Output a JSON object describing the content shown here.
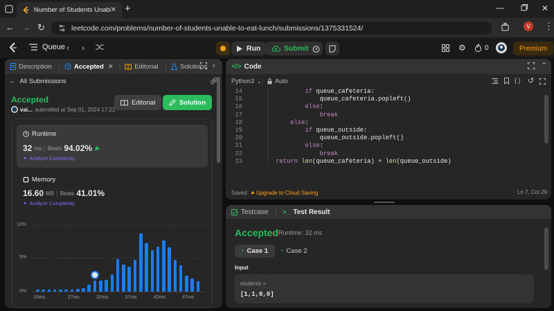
{
  "browser": {
    "tab_title": "Number of Students Unable to",
    "url": "leetcode.com/problems/number-of-students-unable-to-eat-lunch/submissions/1375331524/",
    "profile_initial": "V"
  },
  "header": {
    "list_label": "Queue",
    "run_label": "Run",
    "submit_label": "Submit",
    "fire_count": "0",
    "premium_label": "Premium"
  },
  "left": {
    "tabs": [
      "Description",
      "Accepted",
      "Editorial",
      "Solutions"
    ],
    "all_submissions": "All Submissions",
    "status": "Accepted",
    "user": "vai...",
    "submitted_at": "submitted at Sep 01, 2024 17:22",
    "editorial_button": "Editorial",
    "solution_button": "Solution",
    "runtime": {
      "label": "Runtime",
      "value": "32",
      "unit": "ms",
      "beats_label": "Beats",
      "beats": "94.02%",
      "analyze": "Analyze Complexity"
    },
    "memory": {
      "label": "Memory",
      "value": "16.60",
      "unit": "MB",
      "beats_label": "Beats",
      "beats": "41.01%",
      "analyze": "Analyze Complexity"
    }
  },
  "chart_data": {
    "type": "bar",
    "yticks": [
      "10%",
      "5%",
      "0%"
    ],
    "ylim": [
      0,
      10
    ],
    "xticks": [
      "10ms",
      "27ms",
      "32ms",
      "37ms",
      "42ms",
      "47ms"
    ],
    "values": [
      0.3,
      0.3,
      0.3,
      0.3,
      0.3,
      0.3,
      0.3,
      0.4,
      0.5,
      1.0,
      1.6,
      1.6,
      1.8,
      2.6,
      4.8,
      4.0,
      3.7,
      4.7,
      8.7,
      7.2,
      6.2,
      6.7,
      7.6,
      6.6,
      4.7,
      3.9,
      2.4,
      2.0,
      1.5
    ],
    "highlight_index": 10
  },
  "code": {
    "title": "Code",
    "language": "Python3",
    "mode": "Auto",
    "lines": [
      {
        "n": "14",
        "indent": 12,
        "parts": [
          {
            "t": "if",
            "c": "kw"
          },
          {
            "t": " queue_cafeteria:",
            "c": ""
          }
        ]
      },
      {
        "n": "15",
        "indent": 16,
        "parts": [
          {
            "t": "queue_cafeteria.popleft()",
            "c": ""
          }
        ]
      },
      {
        "n": "16",
        "indent": 12,
        "parts": [
          {
            "t": "else",
            "c": "kw"
          },
          {
            "t": ":",
            "c": ""
          }
        ]
      },
      {
        "n": "17",
        "indent": 16,
        "parts": [
          {
            "t": "break",
            "c": "kw"
          }
        ]
      },
      {
        "n": "18",
        "indent": 8,
        "parts": [
          {
            "t": "else",
            "c": "kw"
          },
          {
            "t": ":",
            "c": ""
          }
        ]
      },
      {
        "n": "19",
        "indent": 12,
        "parts": [
          {
            "t": "if",
            "c": "kw"
          },
          {
            "t": " queue_outside:",
            "c": ""
          }
        ]
      },
      {
        "n": "20",
        "indent": 16,
        "parts": [
          {
            "t": "queue_outside.popleft()",
            "c": ""
          }
        ]
      },
      {
        "n": "21",
        "indent": 12,
        "parts": [
          {
            "t": "else",
            "c": "kw"
          },
          {
            "t": ":",
            "c": ""
          }
        ]
      },
      {
        "n": "22",
        "indent": 16,
        "parts": [
          {
            "t": "break",
            "c": "kw"
          }
        ]
      },
      {
        "n": "23",
        "indent": 4,
        "parts": [
          {
            "t": "return",
            "c": "kw"
          },
          {
            "t": " ",
            "c": ""
          },
          {
            "t": "len",
            "c": "fn"
          },
          {
            "t": "(queue_cafeteria) + ",
            "c": ""
          },
          {
            "t": "len",
            "c": "fn"
          },
          {
            "t": "(queue_outside)",
            "c": ""
          }
        ]
      }
    ],
    "saved": "Saved",
    "upgrade": "Upgrade to Cloud Saving",
    "cursor": "Ln 7, Col 29"
  },
  "result": {
    "tab_testcase": "Testcase",
    "tab_result": "Test Result",
    "status": "Accepted",
    "runtime": "Runtime: 32 ms",
    "cases": [
      "Case 1",
      "Case 2"
    ],
    "input_label": "Input",
    "var_name": "students =",
    "var_value": "[1,1,0,0]"
  },
  "colors": {
    "accent_green": "#2cbb5d",
    "premium": "#ffa116",
    "bar_blue": "#1a7cf1"
  }
}
